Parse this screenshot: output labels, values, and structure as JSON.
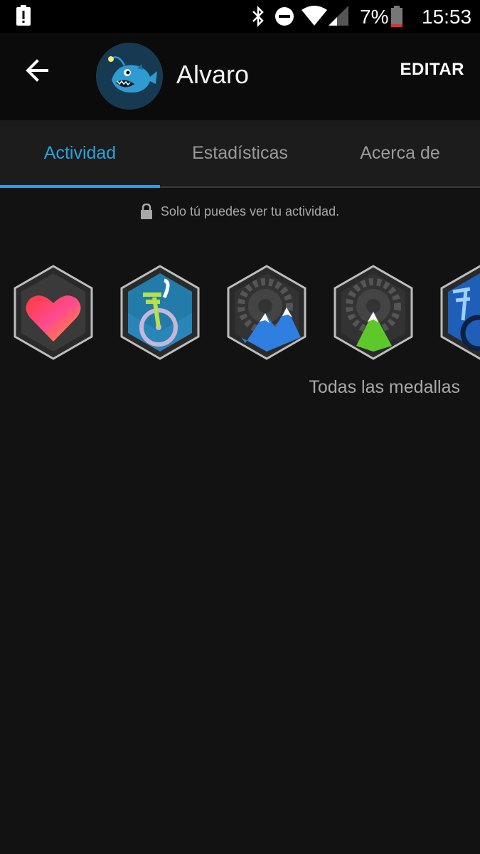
{
  "status_bar": {
    "battery_percent": "7%",
    "time": "15:53",
    "icons": [
      "alert-icon",
      "bluetooth-icon",
      "do-not-disturb-icon",
      "wifi-icon",
      "cell-signal-icon",
      "battery-icon"
    ]
  },
  "header": {
    "back_icon": "arrow-left-icon",
    "name": "Alvaro",
    "edit_label": "EDITAR",
    "avatar_icon": "anglerfish-avatar"
  },
  "tabs": [
    {
      "label": "Actividad",
      "active": true
    },
    {
      "label": "Estadísticas",
      "active": false
    },
    {
      "label": "Acerca de",
      "active": false
    }
  ],
  "privacy_note": "Solo tú puedes ver tu actividad.",
  "badges": [
    {
      "icon": "heart-badge-icon"
    },
    {
      "icon": "unicycle-badge-icon"
    },
    {
      "icon": "gear-mountain-blue-badge-icon"
    },
    {
      "icon": "gear-mountain-green-badge-icon"
    },
    {
      "icon": "bike-badge-icon"
    }
  ],
  "all_badges_label": "Todas las medallas",
  "colors": {
    "accent": "#2aa2dc",
    "background": "#121212",
    "tab_bar": "#1c1c1c"
  }
}
